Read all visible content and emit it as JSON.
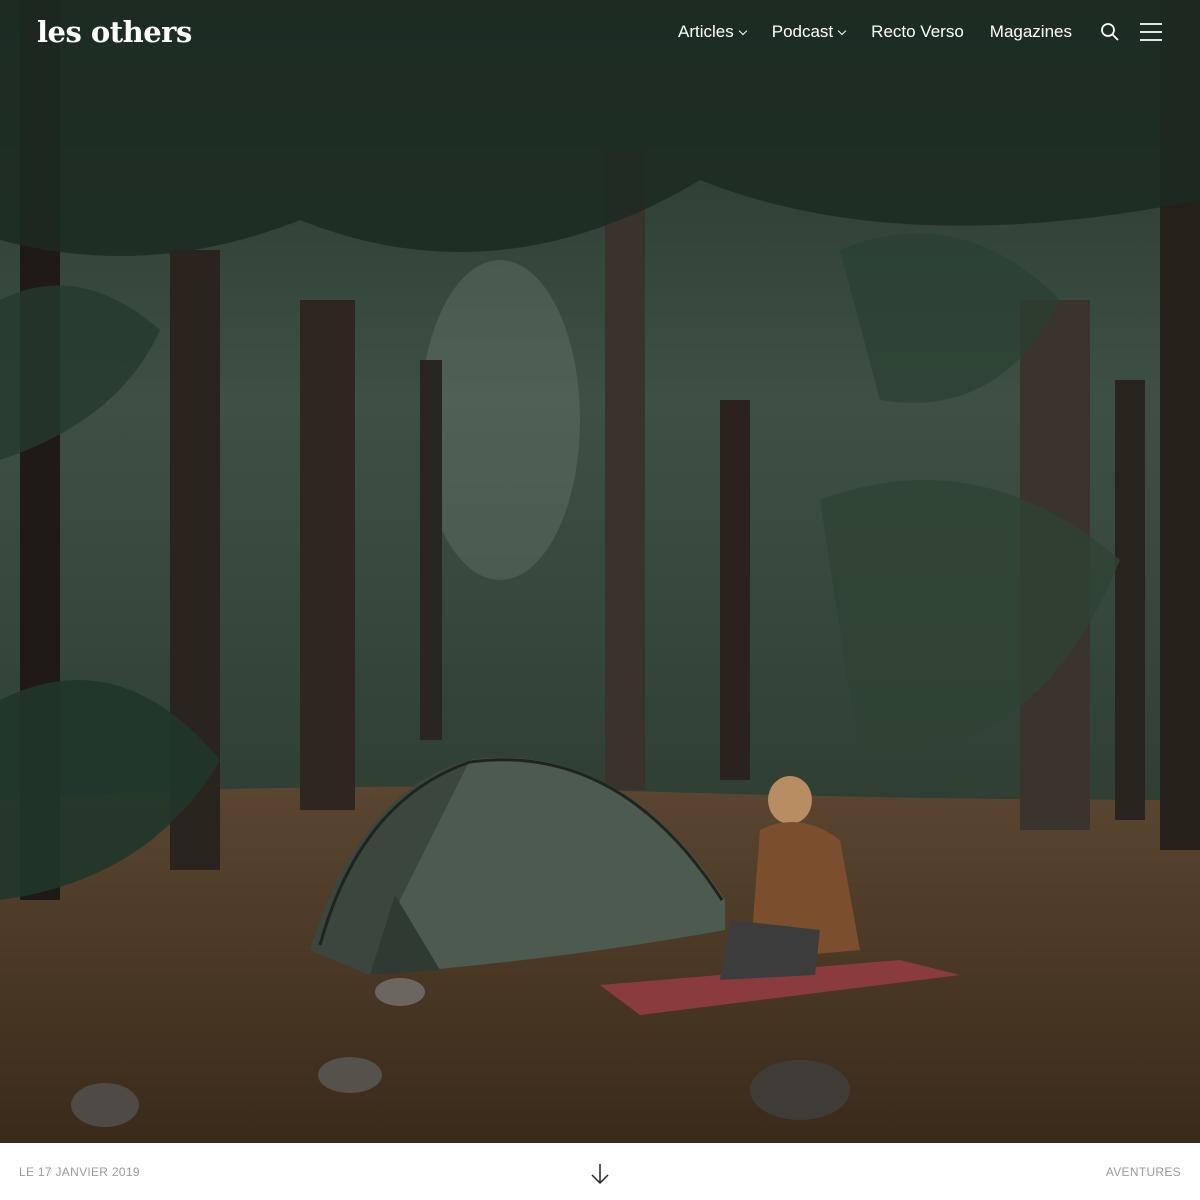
{
  "brand": {
    "logo_text": "les others"
  },
  "nav": {
    "items": [
      {
        "label": "Articles",
        "has_dropdown": true
      },
      {
        "label": "Podcast",
        "has_dropdown": true
      },
      {
        "label": "Recto Verso",
        "has_dropdown": false
      },
      {
        "label": "Magazines",
        "has_dropdown": false
      }
    ],
    "search_icon": "search-icon",
    "menu_icon": "hamburger-menu-icon"
  },
  "hero": {
    "image_icon": "forest-camping-photo"
  },
  "footer": {
    "date": "LE 17 JANVIER 2019",
    "category": "AVENTURES",
    "scroll_icon": "arrow-down-icon"
  },
  "colors": {
    "nav_text": "#ffffff",
    "footer_text": "#9a9a9a",
    "footer_bg": "#ffffff"
  }
}
